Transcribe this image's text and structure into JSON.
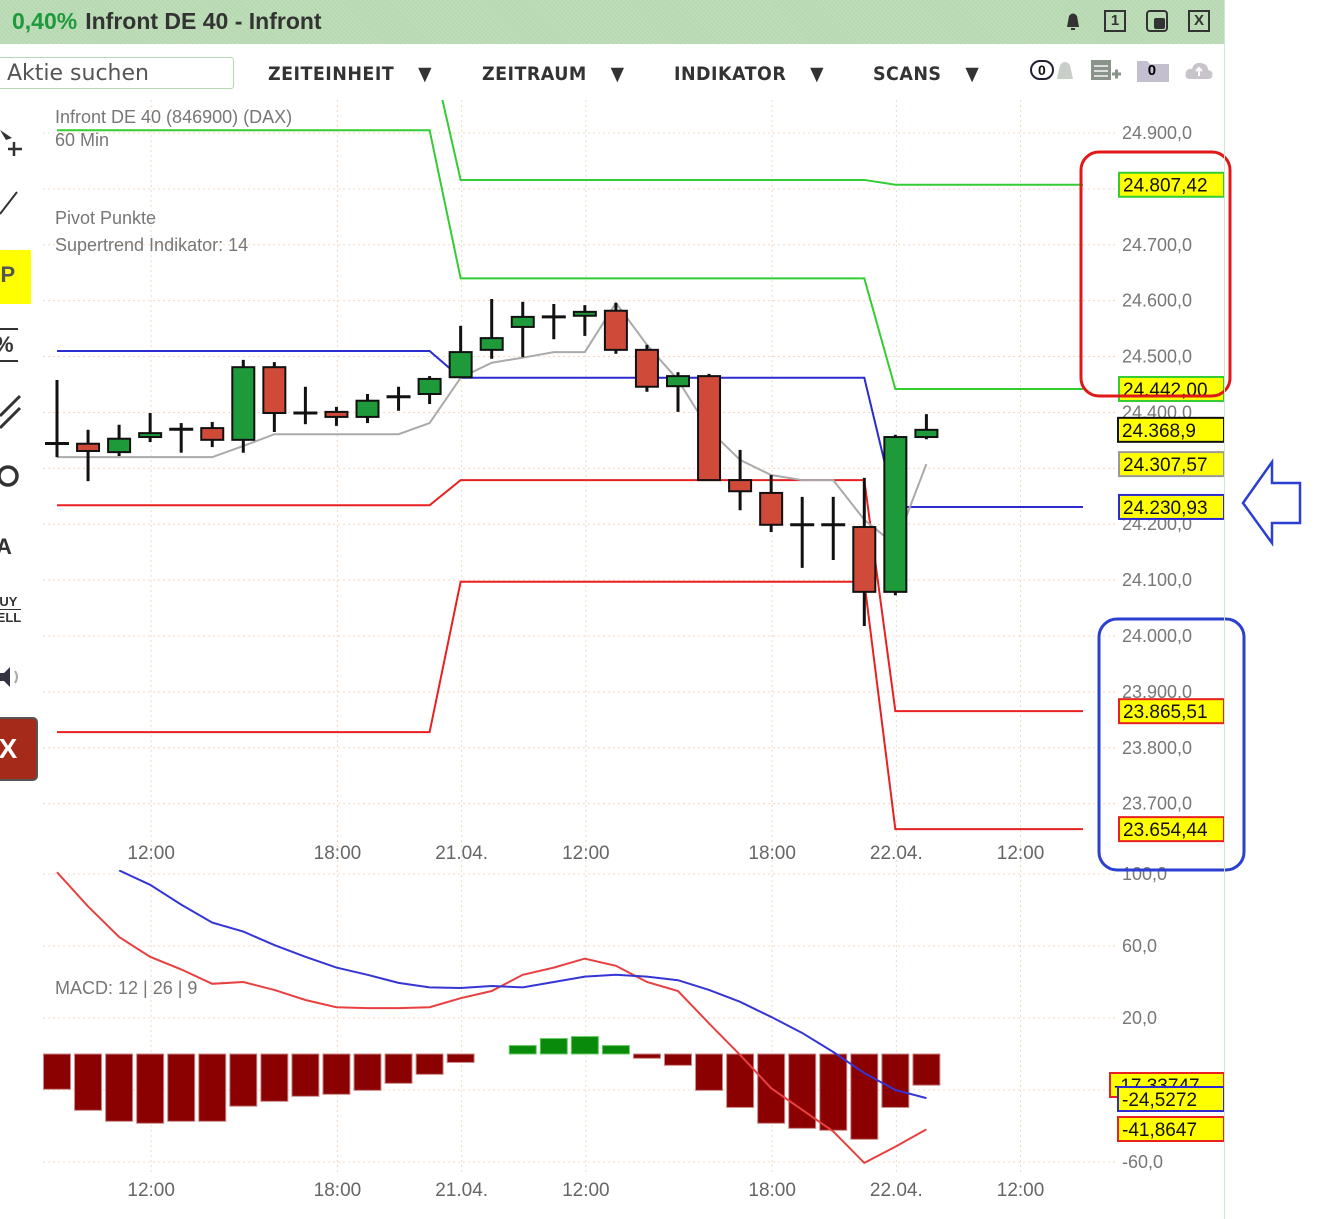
{
  "window": {
    "change_pct": "0,40%",
    "title": "Infront DE 40 - Infront",
    "icons": [
      "bell-icon",
      "one-window-icon",
      "restore-window-icon",
      "close-icon"
    ],
    "one_label": "1",
    "close_label": "X"
  },
  "toolbar": {
    "search_placeholder": "Aktie suchen",
    "menus": [
      {
        "label": "ZEITEINHEIT",
        "arrow": "▼"
      },
      {
        "label": "ZEITRAUM",
        "arrow": "▼"
      },
      {
        "label": "INDIKATOR",
        "arrow": "▼"
      },
      {
        "label": "SCANS",
        "arrow": "▼"
      }
    ],
    "alarm_count": "0",
    "folder_count": "0"
  },
  "left_tools": [
    {
      "icon": "cursor-crosshair-icon"
    },
    {
      "icon": "trendline-icon"
    },
    {
      "icon": "fp-icon",
      "label": "FP"
    },
    {
      "icon": "percent-icon",
      "label": "%"
    },
    {
      "icon": "parallel-lines-icon"
    },
    {
      "icon": "circle-icon",
      "label": "O"
    },
    {
      "icon": "text-icon",
      "label": "A"
    },
    {
      "icon": "buy-sell-icon",
      "label_top": "BUY",
      "label_bottom": "SELL"
    },
    {
      "icon": "speaker-icon"
    },
    {
      "icon": "delete-icon",
      "label": "X"
    }
  ],
  "legend": {
    "instrument": "Infront DE 40 (846900) (DAX)",
    "interval": "60 Min",
    "pivot": "Pivot Punkte",
    "supertrend": "Supertrend Indikator: 14",
    "macd": "MACD: 12 | 26 | 9"
  },
  "colors": {
    "up": "#1f9a3a",
    "down": "#d04a3a",
    "resistance": "#33cc33",
    "pivot": "#2b2bd0",
    "support": "#e82020",
    "supertrend": "#aaaaaa",
    "macd": "#e84040",
    "signal": "#3535d5",
    "hist_neg": "#8b0000",
    "hist_pos": "#0a8a0a",
    "annot_red": "#e01818",
    "annot_blue": "#2b3fd0"
  },
  "chart_data": [
    {
      "type": "candlestick",
      "title": "Infront DE 40 (846900) (DAX)",
      "interval": "60 Min",
      "ylim": [
        23620,
        24960
      ],
      "grid": true,
      "x_ticks": [
        {
          "label": "12:00",
          "index": 3
        },
        {
          "label": "18:00",
          "index": 9
        },
        {
          "label": "21.04.",
          "index": 13
        },
        {
          "label": "12:00",
          "index": 17
        },
        {
          "label": "18:00",
          "index": 23
        },
        {
          "label": "22.04.",
          "index": 27
        },
        {
          "label": "12:00",
          "index": 31
        }
      ],
      "y_ticks": [
        {
          "label": "24.900,0",
          "value": 24900
        },
        {
          "label": "24.700,0",
          "value": 24700
        },
        {
          "label": "24.600,0",
          "value": 24600
        },
        {
          "label": "24.500,0",
          "value": 24500
        },
        {
          "label": "24.400,0",
          "value": 24400
        },
        {
          "label": "24.200,0",
          "value": 24200
        },
        {
          "label": "24.100,0",
          "value": 24100
        },
        {
          "label": "24.000,0",
          "value": 24000
        },
        {
          "label": "23.900,0",
          "value": 23900
        },
        {
          "label": "23.800,0",
          "value": 23800
        },
        {
          "label": "23.700,0",
          "value": 23700
        }
      ],
      "candles": [
        [
          24344,
          24458,
          24320,
          24345
        ],
        [
          24344,
          24369,
          24277,
          24331
        ],
        [
          24329,
          24378,
          24322,
          24353
        ],
        [
          24356,
          24399,
          24347,
          24363
        ],
        [
          24370,
          24381,
          24328,
          24370
        ],
        [
          24372,
          24383,
          24338,
          24351
        ],
        [
          24351,
          24494,
          24328,
          24481
        ],
        [
          24481,
          24490,
          24365,
          24399
        ],
        [
          24399,
          24446,
          24379,
          24399
        ],
        [
          24401,
          24410,
          24376,
          24392
        ],
        [
          24392,
          24433,
          24381,
          24421
        ],
        [
          24428,
          24446,
          24403,
          24428
        ],
        [
          24433,
          24465,
          24415,
          24460
        ],
        [
          24463,
          24555,
          24462,
          24508
        ],
        [
          24512,
          24603,
          24496,
          24533
        ],
        [
          24553,
          24598,
          24499,
          24571
        ],
        [
          24571,
          24594,
          24531,
          24571
        ],
        [
          24573,
          24592,
          24537,
          24580
        ],
        [
          24582,
          24596,
          24505,
          24512
        ],
        [
          24512,
          24521,
          24437,
          24446
        ],
        [
          24447,
          24472,
          24401,
          24465
        ],
        [
          24465,
          24469,
          24279,
          24279
        ],
        [
          24279,
          24333,
          24225,
          24259
        ],
        [
          24256,
          24288,
          24186,
          24199
        ],
        [
          24199,
          24249,
          24122,
          24199
        ],
        [
          24199,
          24249,
          24136,
          24199
        ],
        [
          24195,
          24283,
          24018,
          24079
        ],
        [
          24079,
          24360,
          24073,
          24356
        ],
        [
          24356,
          24397,
          24352,
          24368.9
        ]
      ],
      "candle_fields": [
        "open",
        "high",
        "low",
        "close"
      ],
      "supertrend": [
        24320,
        24320,
        24320,
        24320,
        24320,
        24320,
        24340,
        24361,
        24361,
        24361,
        24361,
        24361,
        24381,
        24462,
        24489,
        24498,
        24508,
        24508,
        24596,
        24521,
        24458,
        24369,
        24315,
        24288,
        24279,
        24279,
        24208,
        24163,
        24307.57
      ],
      "pivot_levels": [
        {
          "kind": "resistance",
          "days": [
            25060,
            24816,
            24807.42
          ]
        },
        {
          "kind": "resistance",
          "days": [
            24905,
            24640,
            24442.0
          ]
        },
        {
          "kind": "pivot",
          "days": [
            24510,
            24462,
            24230.93
          ]
        },
        {
          "kind": "support",
          "days": [
            24234,
            24279,
            23865.51
          ]
        },
        {
          "kind": "support",
          "days": [
            23828,
            24097,
            23654.44
          ]
        }
      ],
      "price_tags": [
        {
          "text": "24.807,42",
          "value": 24807.42,
          "border": "#33cc33"
        },
        {
          "text": "24.442,00",
          "value": 24442.0,
          "border": "#33cc33"
        },
        {
          "text": "24.368,9",
          "value": 24368.9,
          "border": "#111111"
        },
        {
          "text": "24.307,57",
          "value": 24307.57,
          "border": "#999999"
        },
        {
          "text": "24.230,93",
          "value": 24230.93,
          "border": "#2b2bd0"
        },
        {
          "text": "23.865,51",
          "value": 23865.51,
          "border": "#e82020"
        },
        {
          "text": "23.654,44",
          "value": 23654.44,
          "border": "#e82020"
        }
      ]
    },
    {
      "type": "bar+line",
      "title": "MACD: 12 | 26 | 9",
      "ylim": [
        -65,
        100
      ],
      "grid": true,
      "y_ticks": [
        {
          "label": "100,0",
          "value": 100
        },
        {
          "label": "60,0",
          "value": 60
        },
        {
          "label": "20,0",
          "value": 20
        },
        {
          "label": "-60,0",
          "value": -60
        }
      ],
      "histogram": [
        -19.6,
        -31.3,
        -37.4,
        -38.5,
        -37.4,
        -37.4,
        -29,
        -26.3,
        -23.5,
        -22.4,
        -20.2,
        -16.3,
        -11.3,
        -4.7,
        0,
        4.7,
        8.6,
        9.7,
        4.7,
        -2.4,
        -6.3,
        -20.2,
        -29.7,
        -38.5,
        -41.3,
        -42.4,
        -47.4,
        -29.7,
        -17.34
      ],
      "macd": [
        101,
        82,
        65,
        54,
        47,
        39,
        40,
        35.6,
        30,
        26,
        25.5,
        25.5,
        26,
        31,
        35,
        44,
        48,
        53,
        49,
        40,
        35,
        17,
        -0.5,
        -19,
        -31,
        -43,
        -60.5,
        -51.5,
        -41.86
      ],
      "signal": [
        null,
        null,
        102,
        94,
        83,
        73,
        68,
        60.5,
        54,
        48,
        44,
        39.5,
        37,
        36.7,
        37.8,
        37,
        40,
        43,
        44,
        43,
        41,
        35.6,
        29,
        20.6,
        11.7,
        1.1,
        -10.6,
        -20,
        -24.53
      ],
      "value_tags": [
        {
          "text": "-17,33747",
          "value": -17.34,
          "border": "#e82020"
        },
        {
          "text": "-24,5272",
          "value": -24.53,
          "border": "#2b2bd0"
        },
        {
          "text": "-41,8647",
          "value": -41.86,
          "border": "#e82020"
        }
      ]
    }
  ]
}
